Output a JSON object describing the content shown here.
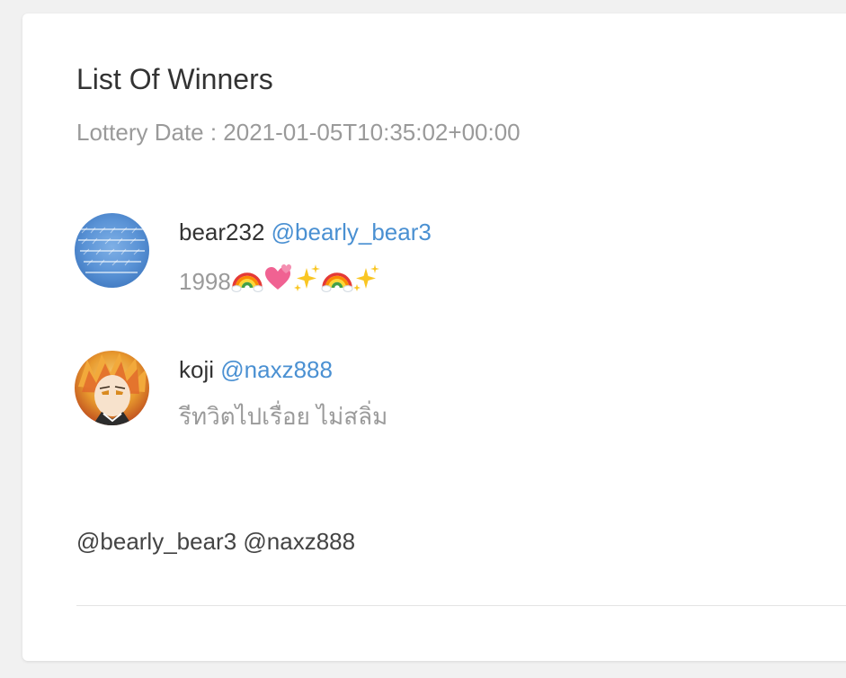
{
  "card": {
    "title": "List Of Winners",
    "lottery_date": "Lottery Date : 2021-01-05T10:35:02+00:00"
  },
  "winners": [
    {
      "name": "bear232",
      "handle": "@bearly_bear3",
      "text": "1998",
      "emoji": [
        "rainbow-icon",
        "two-hearts-icon",
        "sparkles-icon",
        "rainbow-icon",
        "sparkles-icon"
      ]
    },
    {
      "name": "koji",
      "handle": "@naxz888",
      "text": "รีทวิตไปเรื่อย ไม่สลิ่ม",
      "emoji": []
    }
  ],
  "mentions": "@bearly_bear3 @naxz888",
  "colors": {
    "page_bg": "#f1f1f1",
    "card_bg": "#ffffff",
    "title": "#333333",
    "muted": "#9a9a9a",
    "handle": "#4a90d2"
  }
}
